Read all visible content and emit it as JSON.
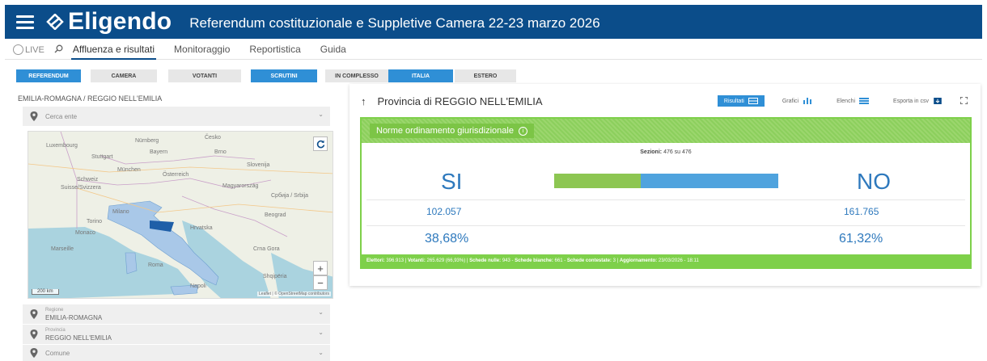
{
  "header": {
    "app_name": "Eligendo",
    "title": "Referendum costituzionale e Suppletive Camera 22-23 marzo 2026",
    "bg_color": "#0b4d8a"
  },
  "nav": {
    "live_label": "LIVE",
    "items": [
      {
        "label": "Affluenza e risultati",
        "active": true
      },
      {
        "label": "Monitoraggio",
        "active": false
      },
      {
        "label": "Reportistica",
        "active": false
      },
      {
        "label": "Guida",
        "active": false
      }
    ]
  },
  "filters": [
    {
      "label": "REFERENDUM",
      "on": true
    },
    {
      "label": "CAMERA",
      "on": false
    },
    {
      "label": "VOTANTI",
      "on": false
    },
    {
      "label": "SCRUTINI",
      "on": true
    },
    {
      "label": "IN COMPLESSO",
      "on": false
    },
    {
      "label": "ITALIA",
      "on": true
    },
    {
      "label": "ESTERO",
      "on": false
    }
  ],
  "left": {
    "breadcrumb": "EMILIA-ROMAGNA / REGGIO NELL'EMILIA",
    "search_placeholder": "Cerca ente",
    "map": {
      "labels": [
        "Luxembourg",
        "Nürnberg",
        "Česko",
        "Stuttgart",
        "Bayern",
        "Brno",
        "München",
        "Österreich",
        "Schweiz",
        "Suisse/Svizzera",
        "Magyarország",
        "Slovenija",
        "Hrvatska",
        "Beograd",
        "Torino",
        "Milano",
        "Monaco",
        "Marseille",
        "Roma",
        "Napoli",
        "Crna Gora",
        "Shqipëria",
        "Србија / Srbija"
      ],
      "scale": "200 km",
      "attribution": "Leaflet | © OpenStreetMap contributors",
      "zoom_in": "+",
      "zoom_out": "−",
      "reset_icon": "refresh-icon"
    },
    "selects": [
      {
        "small": "Regione",
        "value": "EMILIA-ROMAGNA"
      },
      {
        "small": "Provincia",
        "value": "REGGIO NELL'EMILIA"
      },
      {
        "small": "",
        "value": "Comune"
      }
    ]
  },
  "card": {
    "title": "Provincia di REGGIO NELL'EMILIA",
    "tools": [
      {
        "label": "Risultati",
        "on": true
      },
      {
        "label": "Grafici",
        "on": false
      },
      {
        "label": "Elenchi",
        "on": false
      },
      {
        "label": "Esporta in csv",
        "on": false
      }
    ]
  },
  "result": {
    "question": "Norme ordinamento giurisdizionale",
    "sezioni_label": "Sezioni:",
    "sezioni_value": "476 su 476",
    "yes_label": "SI",
    "no_label": "NO",
    "yes_votes": "102.057",
    "no_votes": "161.765",
    "yes_pct": "38,68%",
    "no_pct": "61,32%",
    "yes_fraction": 0.3868,
    "yes_color": "#8dc652",
    "no_color": "#4fa3de",
    "footer": {
      "elettori_label": "Elettori:",
      "elettori": "396.913",
      "votanti_label": "Votanti:",
      "votanti": "265.629 (66,93%)",
      "nulle_label": "Schede nulle:",
      "nulle": "943",
      "bianche_label": "Schede bianche:",
      "bianche": "661",
      "contestate_label": "Schede contestate:",
      "contestate": "3",
      "agg_label": "Aggiornamento:",
      "agg": "23/03/2026 - 18:11"
    }
  }
}
